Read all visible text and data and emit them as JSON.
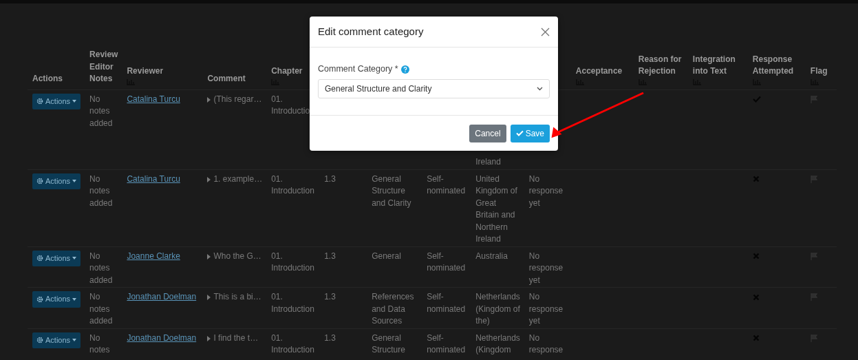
{
  "table": {
    "columns_left": [
      {
        "label": "Actions",
        "sort_icon": false
      },
      {
        "label": "Review Editor Notes",
        "sort_icon": false
      },
      {
        "label": "Reviewer",
        "sort_icon": true
      },
      {
        "label": "Comment",
        "sort_icon": false
      },
      {
        "label": "Chapter",
        "sort_icon": true
      }
    ],
    "columns_right": [
      {
        "label": "Acceptance",
        "sort_icon": true
      },
      {
        "label": "Reason for Rejection",
        "sort_icon": true
      },
      {
        "label": "Integration into Text",
        "sort_icon": true
      },
      {
        "label": "Response Attempted",
        "sort_icon": true
      },
      {
        "label": "Flag",
        "sort_icon": true
      }
    ],
    "rows": [
      {
        "cells": [
          {
            "kind": "actions",
            "label": "Actions"
          },
          {
            "kind": "text",
            "text": "No notes added"
          },
          {
            "kind": "link",
            "text": "Catalina Turcu"
          },
          {
            "kind": "expander",
            "text": "(This regar…"
          },
          {
            "kind": "text",
            "text": "01. Introductio"
          },
          {
            "kind": "covered"
          },
          {
            "kind": "covered"
          },
          {
            "kind": "covered"
          },
          {
            "kind": "tail",
            "text": "Ireland"
          },
          {
            "kind": "covered"
          },
          {
            "kind": "empty"
          },
          {
            "kind": "empty"
          },
          {
            "kind": "empty"
          },
          {
            "kind": "mark",
            "checked": true
          },
          {
            "kind": "flag"
          }
        ]
      },
      {
        "cells": [
          {
            "kind": "actions",
            "label": "Actions"
          },
          {
            "kind": "text",
            "text": "No notes added"
          },
          {
            "kind": "link",
            "text": "Catalina Turcu"
          },
          {
            "kind": "expander",
            "text": "1. example…"
          },
          {
            "kind": "text",
            "text": "01. Introduction"
          },
          {
            "kind": "text",
            "text": "1.3"
          },
          {
            "kind": "text",
            "text": "General Structure and Clarity"
          },
          {
            "kind": "text",
            "text": "Self-nominated"
          },
          {
            "kind": "text",
            "text": "United Kingdom of Great Britain and Northern Ireland"
          },
          {
            "kind": "text",
            "text": "No response yet"
          },
          {
            "kind": "empty"
          },
          {
            "kind": "empty"
          },
          {
            "kind": "empty"
          },
          {
            "kind": "mark",
            "checked": false
          },
          {
            "kind": "flag"
          }
        ]
      },
      {
        "cells": [
          {
            "kind": "actions",
            "label": "Actions"
          },
          {
            "kind": "text",
            "text": "No notes added"
          },
          {
            "kind": "link",
            "text": "Joanne Clarke"
          },
          {
            "kind": "expander",
            "text": "Who the G…"
          },
          {
            "kind": "text",
            "text": "01. Introduction"
          },
          {
            "kind": "text",
            "text": "1.3"
          },
          {
            "kind": "text",
            "text": "General"
          },
          {
            "kind": "text",
            "text": "Self-nominated"
          },
          {
            "kind": "text",
            "text": "Australia"
          },
          {
            "kind": "text",
            "text": "No response yet"
          },
          {
            "kind": "empty"
          },
          {
            "kind": "empty"
          },
          {
            "kind": "empty"
          },
          {
            "kind": "mark",
            "checked": false
          },
          {
            "kind": "flag"
          }
        ]
      },
      {
        "cells": [
          {
            "kind": "actions",
            "label": "Actions"
          },
          {
            "kind": "text",
            "text": "No notes added"
          },
          {
            "kind": "link",
            "text": "Jonathan Doelman"
          },
          {
            "kind": "expander",
            "text": "This is a bi…"
          },
          {
            "kind": "text",
            "text": "01. Introduction"
          },
          {
            "kind": "text",
            "text": "1.3"
          },
          {
            "kind": "text",
            "text": "References and Data Sources"
          },
          {
            "kind": "text",
            "text": "Self-nominated"
          },
          {
            "kind": "text",
            "text": "Netherlands (Kingdom of the)"
          },
          {
            "kind": "text",
            "text": "No response yet"
          },
          {
            "kind": "empty"
          },
          {
            "kind": "empty"
          },
          {
            "kind": "empty"
          },
          {
            "kind": "mark",
            "checked": false
          },
          {
            "kind": "flag"
          }
        ]
      },
      {
        "cells": [
          {
            "kind": "actions",
            "label": "Actions"
          },
          {
            "kind": "text",
            "text": "No notes"
          },
          {
            "kind": "link",
            "text": "Jonathan Doelman"
          },
          {
            "kind": "expander",
            "text": "I find the t…"
          },
          {
            "kind": "text",
            "text": "01. Introduction"
          },
          {
            "kind": "text",
            "text": "1.3"
          },
          {
            "kind": "text",
            "text": "General Structure"
          },
          {
            "kind": "text",
            "text": "Self-nominated"
          },
          {
            "kind": "text",
            "text": "Netherlands (Kingdom"
          },
          {
            "kind": "text",
            "text": "No response"
          },
          {
            "kind": "empty"
          },
          {
            "kind": "empty"
          },
          {
            "kind": "empty"
          },
          {
            "kind": "mark",
            "checked": false
          },
          {
            "kind": "flag"
          }
        ]
      }
    ]
  },
  "modal": {
    "title": "Edit comment category",
    "field": {
      "label": "Comment Category *",
      "value": "General Structure and Clarity"
    },
    "buttons": [
      {
        "kind": "secondary",
        "label": "Cancel"
      },
      {
        "kind": "primary",
        "label": "Save"
      }
    ]
  }
}
